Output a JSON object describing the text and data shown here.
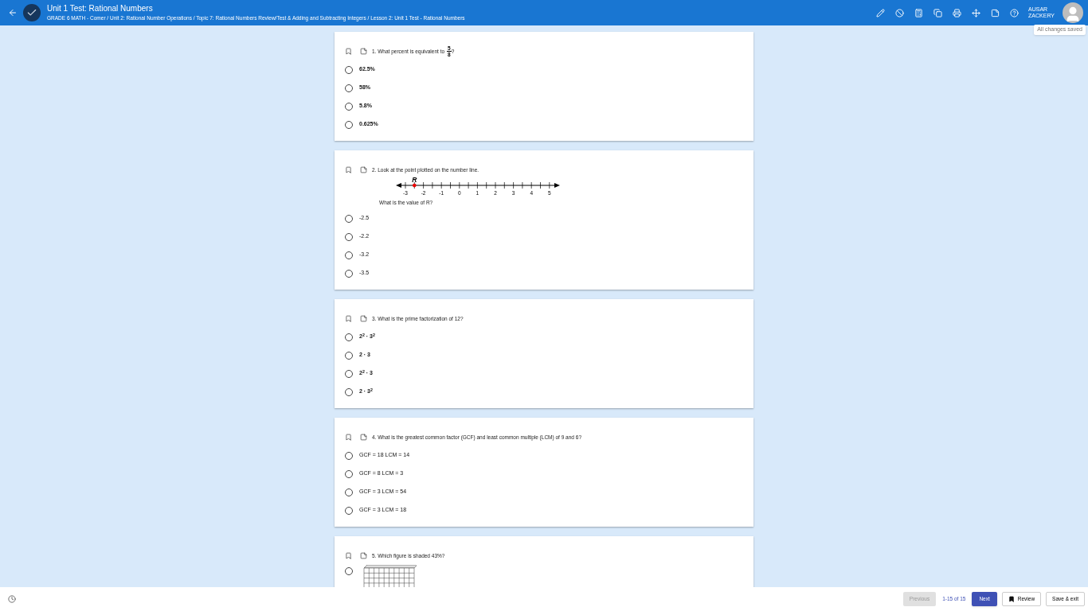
{
  "header": {
    "title": "Unit 1 Test: Rational Numbers",
    "breadcrumb": "GRADE 6 MATH - Comer / Unit 2: Rational Number Operations / Topic 7: Rational Numbers Review/Test & Adding and Subtracting Integers / Lesson 2: Unit 1 Test - Rational Numbers",
    "user_first": "AUSAR",
    "user_last": "ZACKERY",
    "save_status": "All changes saved"
  },
  "questions": [
    {
      "text": "1. What percent is equivalent to",
      "fraction": {
        "num": "5",
        "den": "8"
      },
      "suffix": "?",
      "options": [
        {
          "kind": "text",
          "label": "62.5%",
          "selected": false
        },
        {
          "kind": "text",
          "label": "58%",
          "selected": false
        },
        {
          "kind": "text",
          "label": "5.8%",
          "selected": false
        },
        {
          "kind": "text",
          "label": "0.625%",
          "selected": false
        }
      ]
    },
    {
      "text": "2. Look at the point plotted on the number line.",
      "number_line": {
        "point_label": "R",
        "ticks": [
          "-3",
          "-2",
          "-1",
          "0",
          "1",
          "2",
          "3",
          "4",
          "5"
        ]
      },
      "subtext": "What is the value of R?",
      "options": [
        {
          "kind": "text",
          "label": "-2.5",
          "selected": false
        },
        {
          "kind": "text",
          "label": "-2.2",
          "selected": false
        },
        {
          "kind": "text",
          "label": "-3.2",
          "selected": false
        },
        {
          "kind": "text",
          "label": "-3.5",
          "selected": false
        }
      ]
    },
    {
      "text": "3. What is the prime factorization of 12?",
      "options": [
        {
          "kind": "text",
          "label": "2$^{2}$ · 3$^{2}$",
          "selected": false
        },
        {
          "kind": "text",
          "label": "2 · 3",
          "selected": false
        },
        {
          "kind": "text",
          "label": "2$^{2}$ · 3",
          "selected": false
        },
        {
          "kind": "text",
          "label": "2 · 3$^{2}$",
          "selected": false
        }
      ]
    },
    {
      "text": "4. What is the greatest common factor (GCF) and least common multiple (LCM) of 9 and 6?",
      "options": [
        {
          "kind": "text",
          "label": "GCF = 18 LCM = 14",
          "selected": false
        },
        {
          "kind": "text",
          "label": "GCF = 8 LCM = 3",
          "selected": false
        },
        {
          "kind": "text",
          "label": "GCF = 3 LCM = 54",
          "selected": false
        },
        {
          "kind": "text",
          "label": "GCF = 3 LCM = 18",
          "selected": false
        }
      ]
    },
    {
      "text": "5. Which figure is shaded 43%?",
      "options": [
        {
          "kind": "figure",
          "selected": false
        }
      ]
    }
  ],
  "footer": {
    "previous": "Previous",
    "previous_disabled": true,
    "range": "1-15 of 15",
    "next": "Next",
    "review": "Review",
    "save_exit": "Save & exit"
  }
}
